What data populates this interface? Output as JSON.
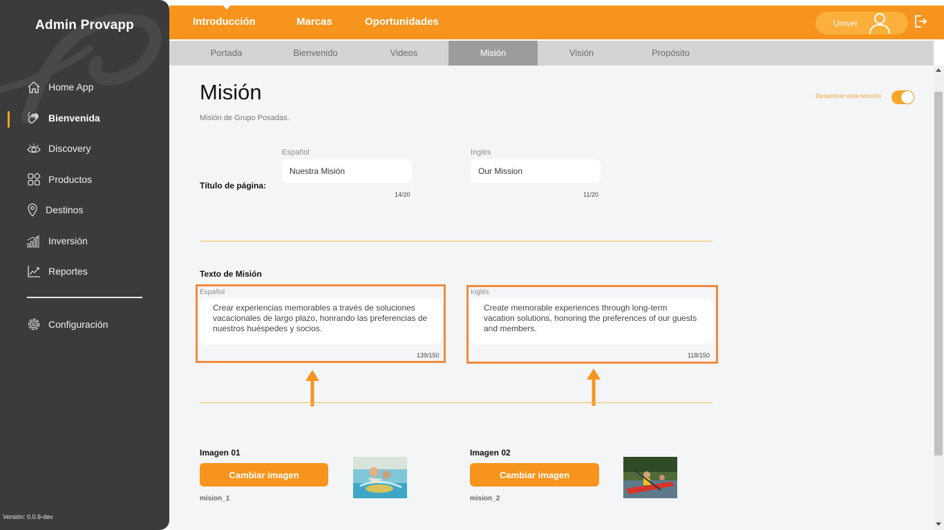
{
  "sidebar": {
    "brand": "Admin Provapp",
    "items": [
      {
        "label": "Home App",
        "icon": "home-icon"
      },
      {
        "label": "Bienvenida",
        "icon": "wave-hand-icon",
        "active": true
      },
      {
        "label": "Discovery",
        "icon": "eye-icon"
      },
      {
        "label": "Productos",
        "icon": "grid-icon"
      },
      {
        "label": "Destinos",
        "icon": "location-pin-icon"
      },
      {
        "label": "Inversión",
        "icon": "bar-chart-icon"
      },
      {
        "label": "Reportes",
        "icon": "trend-chart-icon"
      }
    ],
    "settings": {
      "label": "Configuración",
      "icon": "gear-icon"
    },
    "version": "Versión: 0.0.9-dev"
  },
  "topbar": {
    "tabs": [
      "Introducción",
      "Marcas",
      "Oportunidades"
    ],
    "user": "Umvel"
  },
  "subtabs": [
    "Portada",
    "Bienvenido",
    "Videos",
    "Misión",
    "Visión",
    "Propósito"
  ],
  "page": {
    "title": "Misión",
    "subtitle": "Misión de Grupo Posadas.",
    "toggle_label": "Desactivar esta sección",
    "title_field": {
      "label": "Título de página:",
      "es": {
        "label": "Español",
        "value": "Nuestra Misión",
        "counter": "14/20"
      },
      "en": {
        "label": "Inglés",
        "value": "Our Mission",
        "counter": "11/20"
      }
    },
    "text_field": {
      "label": "Texto de Misión",
      "es": {
        "label": "Español",
        "value": "Crear experiencias memorables a través de soluciones vacacionales de largo plazo, honrando las preferencias de nuestros huéspedes y socios.",
        "counter": "139/150"
      },
      "en": {
        "label": "Inglés",
        "value": "Create memorable experiences through long-term vacation solutions, honoring the preferences of our guests and members.",
        "counter": "118/150"
      }
    },
    "images": [
      {
        "label": "Imagen 01",
        "button": "Cambiar imagen",
        "name": "mision_1"
      },
      {
        "label": "Imagen 02",
        "button": "Cambiar imagen",
        "name": "mision_2"
      }
    ]
  },
  "colors": {
    "accent": "#f7941d",
    "sidebar": "#3b3b3b",
    "highlight": "#f08a3c"
  }
}
